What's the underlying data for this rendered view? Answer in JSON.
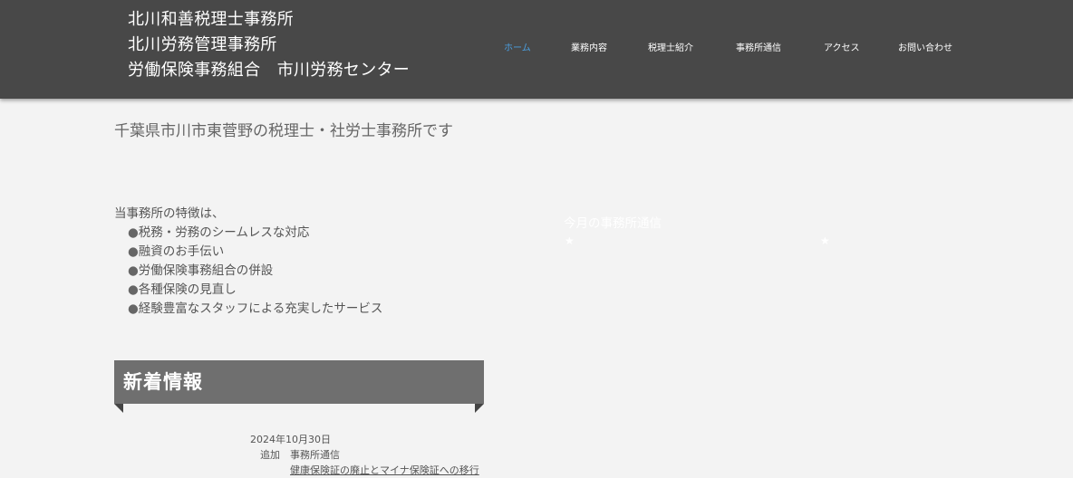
{
  "header": {
    "office_names": [
      "北川和善税理士事務所",
      "北川労務管理事務所",
      "労働保険事務組合　市川労務センター"
    ]
  },
  "nav": {
    "items": [
      {
        "label": "ホーム",
        "active": true
      },
      {
        "label": "業務内容",
        "active": false
      },
      {
        "label": "税理士紹介",
        "active": false
      },
      {
        "label": "事務所通信",
        "active": false
      },
      {
        "label": "アクセス",
        "active": false
      },
      {
        "label": "お問い合わせ",
        "active": false
      }
    ],
    "active_color": "#4a9fe0"
  },
  "main": {
    "tagline": "千葉県市川市東菅野の税理士・社労士事務所です",
    "features_intro": "当事務所の特徴は、",
    "features": [
      "税務・労務のシームレスな対応",
      "融資のお手伝い",
      "労働保険事務組合の併設",
      "各種保険の見直し",
      "経験豊富なスタッフによる充実したサービス"
    ],
    "bullet": "●"
  },
  "newsletter": {
    "title": "今月の事務所通信",
    "star": "★"
  },
  "news": {
    "heading": "新着情報",
    "items": [
      {
        "date": "2024年10月30日",
        "type": "追加",
        "category": "事務所通信",
        "link": "健康保険証の廃止とマイナ保険証への移行"
      }
    ]
  },
  "colors": {
    "header_bg": "#484848",
    "page_bg": "#f3f3f3",
    "news_heading_bg": "#6f6f6f"
  }
}
